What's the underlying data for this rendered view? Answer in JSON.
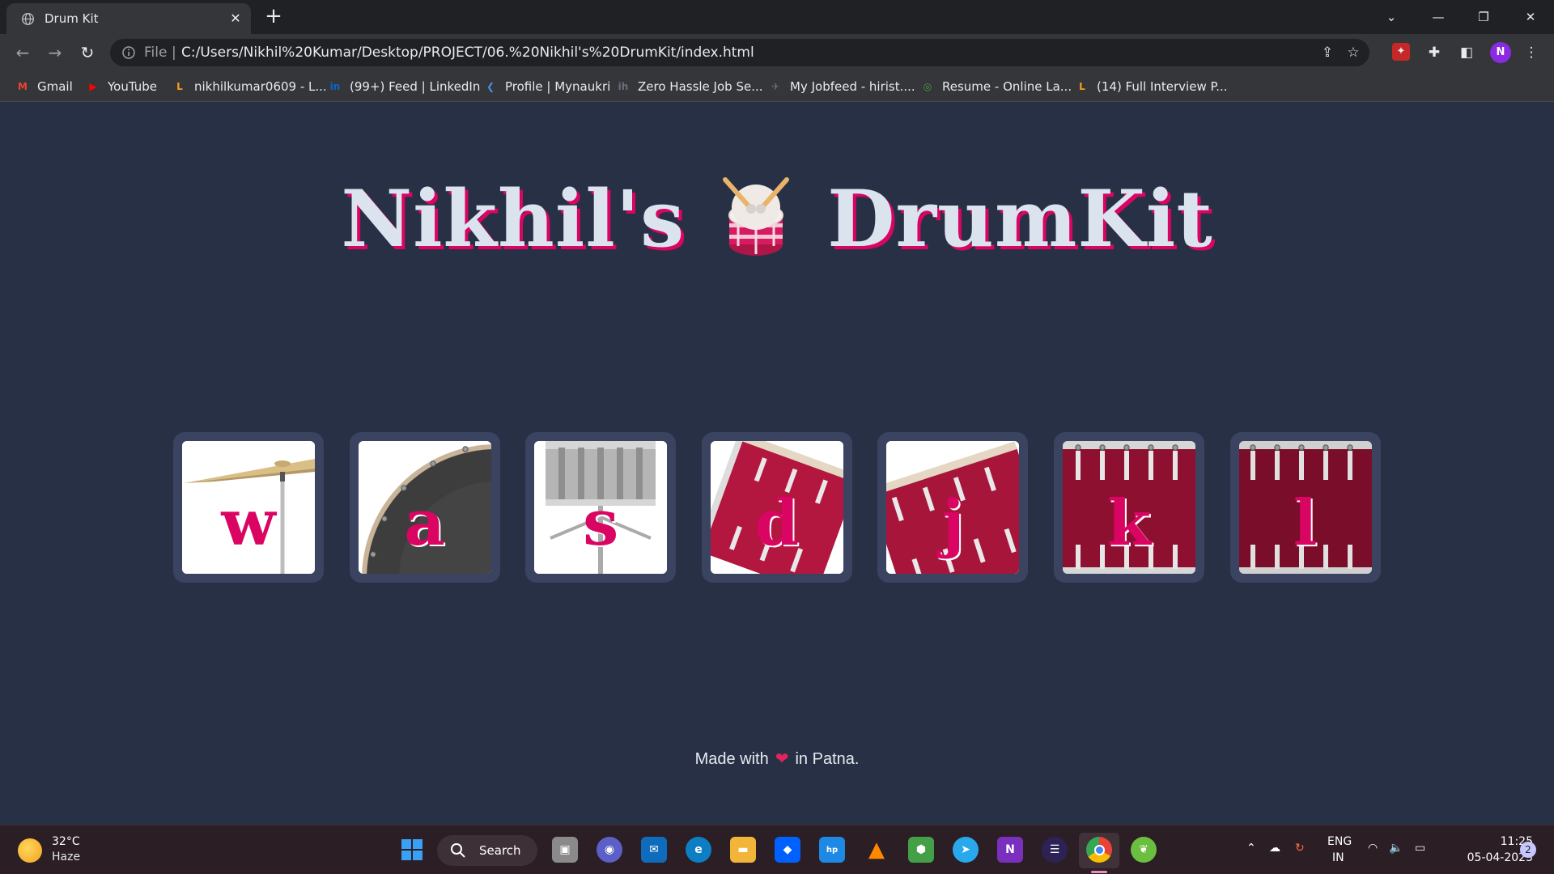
{
  "browser": {
    "tab_title": "Drum Kit",
    "tab_close": "✕",
    "new_tab": "+",
    "address_scheme": "File",
    "address_separator": "|",
    "url": "C:/Users/Nikhil%20Kumar/Desktop/PROJECT/06.%20Nikhil's%20DrumKit/index.html",
    "profile_initial": "N",
    "bookmarks": [
      {
        "label": "Gmail",
        "icon": "gmail-icon",
        "badge": "M",
        "color": "#ea4335"
      },
      {
        "label": "YouTube",
        "icon": "youtube-icon",
        "badge": "▶",
        "color": "#ff0000"
      },
      {
        "label": "nikhilkumar0609 - L...",
        "icon": "leetcode-icon",
        "badge": "L",
        "color": "#f89f1b"
      },
      {
        "label": "(99+) Feed | LinkedIn",
        "icon": "linkedin-icon",
        "badge": "in",
        "color": "#0a66c2"
      },
      {
        "label": "Profile | Mynaukri",
        "icon": "naukri-icon",
        "badge": "❮",
        "color": "#4a90e2"
      },
      {
        "label": "Zero Hassle Job Se...",
        "icon": "iimjobs-icon",
        "badge": "ih",
        "color": "#6b6f7a"
      },
      {
        "label": "My Jobfeed - hirist....",
        "icon": "hirist-icon",
        "badge": "✈",
        "color": "#6b6f7a"
      },
      {
        "label": "Resume - Online La...",
        "icon": "overleaf-icon",
        "badge": "◎",
        "color": "#47a141"
      },
      {
        "label": "(14) Full Interview P...",
        "icon": "leetcode-icon",
        "badge": "L",
        "color": "#f89f1b"
      }
    ]
  },
  "page": {
    "title_left": "Nikhil's",
    "title_right": "DrumKit",
    "drums": [
      {
        "key": "w",
        "instrument": "crash"
      },
      {
        "key": "a",
        "instrument": "kick"
      },
      {
        "key": "s",
        "instrument": "snare"
      },
      {
        "key": "d",
        "instrument": "tom1"
      },
      {
        "key": "j",
        "instrument": "tom2"
      },
      {
        "key": "k",
        "instrument": "tom3"
      },
      {
        "key": "l",
        "instrument": "tom4"
      }
    ],
    "footer_pre": "Made with",
    "footer_heart": "❤",
    "footer_post": "in Patna."
  },
  "taskbar": {
    "temperature": "32°C",
    "weather": "Haze",
    "search_label": "Search",
    "language_top": "ENG",
    "language_bottom": "IN",
    "time": "11:25",
    "date": "05-04-2023",
    "notification_count": "2"
  },
  "colors": {
    "background": "#283046",
    "accent": "#da0463",
    "title_text": "#dbe4ee",
    "drum_frame": "#3a4460"
  }
}
